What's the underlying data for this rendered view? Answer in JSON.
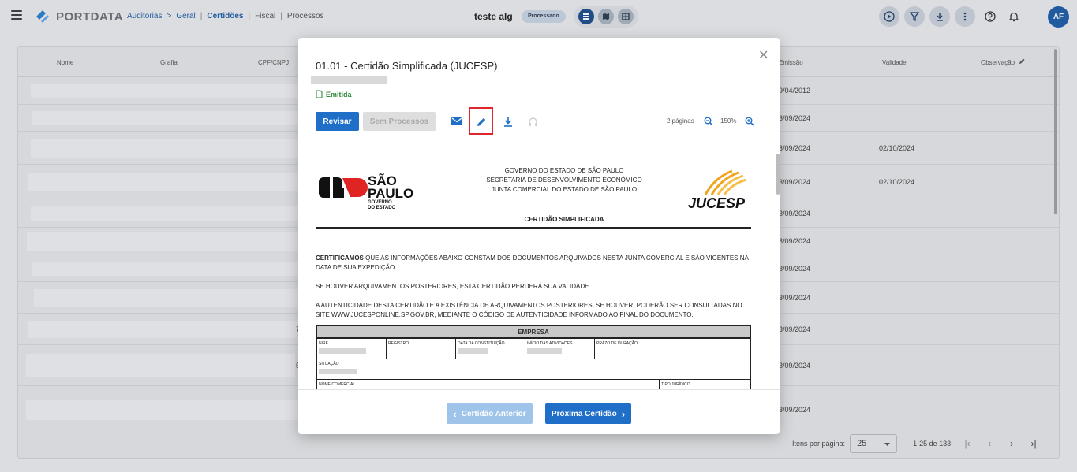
{
  "header": {
    "brand": "PORTDATA",
    "breadcrumbs": [
      "Auditorias",
      ">",
      "Geral",
      "|",
      "Certidões",
      "|",
      "Fiscal",
      "|",
      "Processos"
    ],
    "project_title": "teste alg",
    "status": "Processado",
    "avatar": "AF",
    "icons": [
      "menu-icon",
      "list-view-icon",
      "map-view-icon",
      "grid-view-icon",
      "play-icon",
      "filter-icon",
      "download-icon",
      "more-vert-icon",
      "help-icon",
      "bell-icon"
    ]
  },
  "table": {
    "columns": [
      "Nome",
      "Grafia",
      "CPF/CNPJ",
      "Emissão",
      "Validade",
      "Observação"
    ],
    "rows": [
      {
        "emissao": "9/04/2012",
        "validade": ""
      },
      {
        "emissao": "3/09/2024",
        "validade": ""
      },
      {
        "emissao": "3/09/2024",
        "validade": "02/10/2024"
      },
      {
        "emissao": "3/09/2024",
        "validade": "02/10/2024"
      },
      {
        "emissao": "3/09/2024",
        "validade": ""
      },
      {
        "emissao": "3/09/2024",
        "validade": ""
      },
      {
        "emissao": "3/09/2024",
        "validade": ""
      },
      {
        "emissao": "3/09/2024",
        "validade": ""
      },
      {
        "emissao": "3/09/2024",
        "validade": ""
      },
      {
        "emissao": "3/09/2024",
        "validade": ""
      },
      {
        "emissao": "3/09/2024",
        "validade": ""
      }
    ],
    "row_digits": [
      "",
      "",
      "",
      "",
      "",
      "",
      "",
      "",
      "7",
      "5",
      ""
    ]
  },
  "pager": {
    "label": "Itens por página:",
    "per_page": "25",
    "range": "1-25 de 133"
  },
  "modal": {
    "title": "01.01 - Certidão Simplificada (JUCESP)",
    "status": "Emitida",
    "buttons": {
      "revisar": "Revisar",
      "sem_processos": "Sem Processos",
      "prev": "Certidão Anterior",
      "next": "Próxima Certidão"
    },
    "pages": "2 páginas",
    "zoom": "150%",
    "accent": "#1f6fc8",
    "highlight": "#e0262a"
  },
  "document": {
    "logo_left": {
      "line1": "SÃO",
      "line2": "PAULO",
      "line3": "GOVERNO",
      "line4": "DO ESTADO"
    },
    "logo_right": "JUCESP",
    "gov_lines": [
      "GOVERNO DO ESTADO DE SÃO PAULO",
      "SECRETARIA DE DESENVOLVIMENTO ECONÔMICO",
      "JUNTA COMERCIAL DO ESTADO DE SÃO PAULO"
    ],
    "title": "CERTIDÃO SIMPLIFICADA",
    "para1_bold": "CERTIFICAMOS",
    "para1": " QUE AS INFORMAÇÕES ABAIXO CONSTAM DOS DOCUMENTOS ARQUIVADOS NESTA JUNTA COMERCIAL E SÃO VIGENTES NA DATA DE SUA EXPEDIÇÃO.",
    "para2": "SE HOUVER ARQUIVAMENTOS POSTERIORES, ESTA CERTIDÃO PERDERÁ SUA VALIDADE.",
    "para3": "A AUTENTICIDADE DESTA CERTIDÃO E A EXISTÊNCIA DE ARQUIVAMENTOS POSTERIORES, SE HOUVER, PODERÃO SER CONSULTADAS NO SITE WWW.JUCESPONLINE.SP.GOV.BR, MEDIANTE O CÓDIGO DE AUTENTICIDADE INFORMADO AO FINAL DO DOCUMENTO.",
    "table_head": "EMPRESA",
    "fields": [
      "NIRE",
      "REGISTRO",
      "DATA DA CONSTITUIÇÃO",
      "INÍCIO DAS ATIVIDADES",
      "PRAZO DE DURAÇÃO",
      "SITUAÇÃO",
      "NOME COMERCIAL",
      "TIPO JURÍDICO"
    ]
  }
}
